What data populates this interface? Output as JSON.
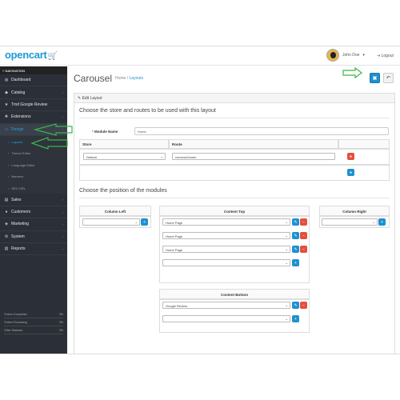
{
  "brand": {
    "name": "opencart",
    "cart_glyph": "🛒"
  },
  "header": {
    "user_name": "John Doe",
    "user_caret": "▾",
    "logout_label": "Logout"
  },
  "sidebar": {
    "nav_title": "≡ NAVIGATION",
    "items": [
      {
        "label": "Dashboard",
        "icon": "dashboard-icon",
        "glyph": "◍"
      },
      {
        "label": "Catalog",
        "icon": "tag-icon",
        "glyph": "◆",
        "chev": "›"
      },
      {
        "label": "Tmd Google Review",
        "icon": "star-icon",
        "glyph": "★"
      },
      {
        "label": "Extensions",
        "icon": "puzzle-icon",
        "glyph": "✚",
        "chev": "›"
      },
      {
        "label": "Design",
        "icon": "monitor-icon",
        "glyph": "▭",
        "chev": "›"
      }
    ],
    "design_sub": [
      {
        "label": "Layouts"
      },
      {
        "label": "Theme Editor"
      },
      {
        "label": "Language Editor"
      },
      {
        "label": "Banners"
      },
      {
        "label": "SEO URL"
      }
    ],
    "items2": [
      {
        "label": "Sales",
        "icon": "cart-icon",
        "glyph": "▤",
        "chev": "›"
      },
      {
        "label": "Customers",
        "icon": "user-icon",
        "glyph": "●",
        "chev": "›"
      },
      {
        "label": "Marketing",
        "icon": "share-icon",
        "glyph": "◈",
        "chev": "›"
      },
      {
        "label": "System",
        "icon": "gear-icon",
        "glyph": "⚙",
        "chev": "›"
      },
      {
        "label": "Reports",
        "icon": "bar-chart-icon",
        "glyph": "▥",
        "chev": "›"
      }
    ],
    "stats": [
      {
        "label": "Orders Completed",
        "value": "0%"
      },
      {
        "label": "Orders Processing",
        "value": "0%"
      },
      {
        "label": "Other Statuses",
        "value": "0%"
      }
    ]
  },
  "page": {
    "title": "Carousel",
    "breadcrumb_home": "Home",
    "breadcrumb_sep": "/",
    "breadcrumb_current": "Layouts",
    "save_glyph": "▣",
    "back_glyph": "↶"
  },
  "panel": {
    "heading": "✎ Edit Layout",
    "legend1": "Choose the store and routes to be used with this layout",
    "module_name_label": "Module Name",
    "required_mark": "* ",
    "module_name_value": "Home",
    "store_header": "Store",
    "route_header": "Route",
    "store_value": "Default",
    "route_value": "common/home",
    "legend2": "Choose the position of the modules",
    "col_left_label": "Column Left",
    "content_top_label": "Content Top",
    "col_right_label": "Column Right",
    "content_bottom_label": "Content Bottom",
    "content_top_modules": [
      "Home Page",
      "Home Page",
      "Home Page",
      ""
    ],
    "content_bottom_modules": [
      "Google Review",
      ""
    ],
    "select_arrow": "⌄",
    "add_glyph": "+",
    "remove_glyph": "−",
    "edit_glyph": "✎",
    "delete_glyph": "●"
  },
  "colors": {
    "accent": "#1e91cf",
    "danger": "#e3503e",
    "sidebar": "#2b3038",
    "annotation_arrow": "#3bb54a"
  }
}
